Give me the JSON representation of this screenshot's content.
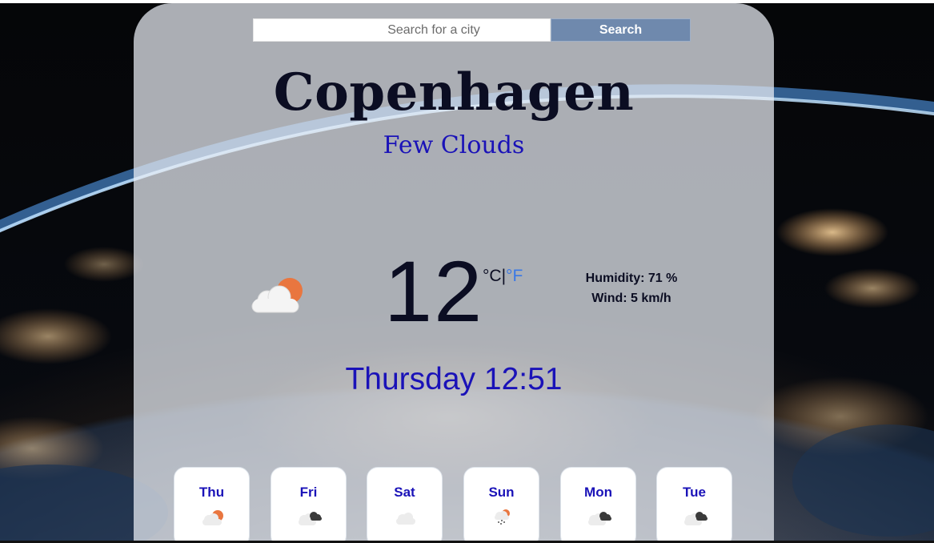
{
  "search": {
    "placeholder": "Search for a city",
    "button_label": "Search"
  },
  "weather": {
    "city": "Copenhagen",
    "description": "Few Clouds",
    "icon": "few-clouds-icon",
    "temperature": "12",
    "unit_celsius": "°C",
    "unit_separator": "|",
    "unit_fahrenheit": "°F",
    "humidity": "Humidity: 71 %",
    "wind": "Wind: 5 km/h",
    "datetime": "Thursday 12:51"
  },
  "forecast": [
    {
      "day": "Thu",
      "icon": "few-clouds-icon"
    },
    {
      "day": "Fri",
      "icon": "broken-clouds-icon"
    },
    {
      "day": "Sat",
      "icon": "scattered-clouds-icon"
    },
    {
      "day": "Sun",
      "icon": "rain-icon"
    },
    {
      "day": "Mon",
      "icon": "broken-clouds-icon"
    },
    {
      "day": "Tue",
      "icon": "broken-clouds-icon"
    }
  ],
  "colors": {
    "accent_blue": "#1a12b8",
    "fahrenheit_link": "#3a78e6",
    "search_button": "#6f89ad",
    "sun_orange": "#e9763f"
  }
}
